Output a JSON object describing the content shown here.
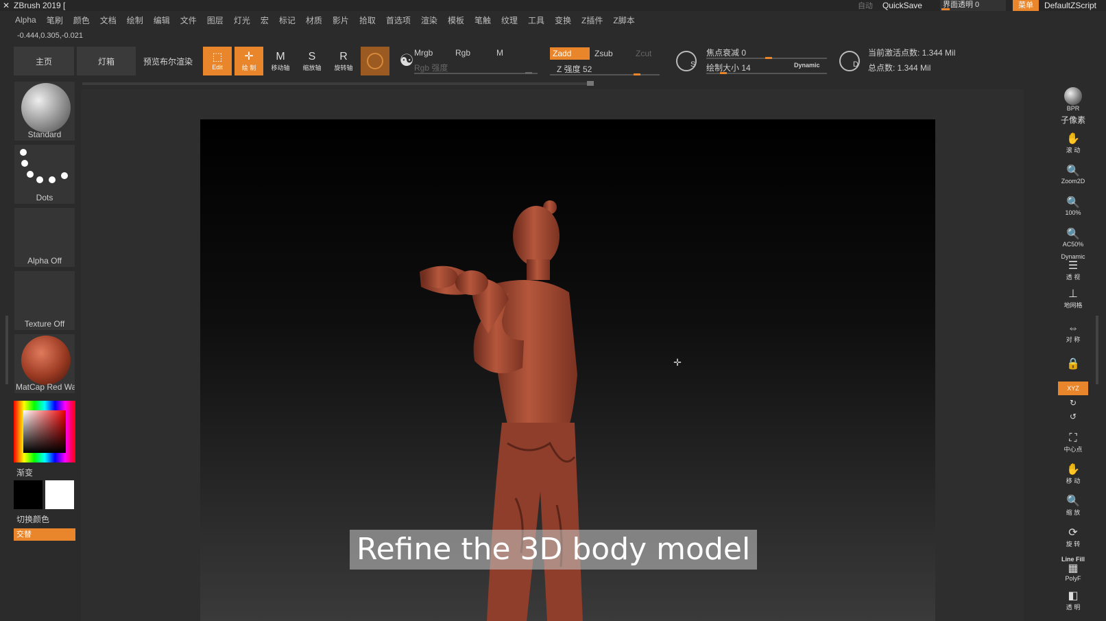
{
  "titlebar": {
    "title": "ZBrush 2019 [",
    "auto_label": "自动",
    "quicksave": "QuickSave",
    "interface_transparency": "界面透明 0",
    "menu_button": "菜单",
    "script_name": "DefaultZScript"
  },
  "menubar": {
    "items": [
      "Alpha",
      "笔刷",
      "颜色",
      "文档",
      "绘制",
      "编辑",
      "文件",
      "图层",
      "灯光",
      "宏",
      "标记",
      "材质",
      "影片",
      "拾取",
      "首选项",
      "渲染",
      "模板",
      "笔触",
      "纹理",
      "工具",
      "变换",
      "Z插件",
      "Z脚本"
    ]
  },
  "coords": "-0.444,0.305,-0.021",
  "shelf": {
    "home": "主页",
    "lightbox": "灯箱",
    "bpr_preview": "预览布尔渲染",
    "edit": "Edit",
    "draw": "绘 制",
    "move": "移动轴",
    "scale": "缩放轴",
    "rotate": "旋转轴",
    "mrgb": "Mrgb",
    "rgb": "Rgb",
    "m": "M",
    "rgb_intensity": "Rgb 强度",
    "zadd": "Zadd",
    "zsub": "Zsub",
    "zcut": "Zcut",
    "z_intensity": "Z 强度 52",
    "focal_shift": "焦点衰减 0",
    "draw_size": "绘制大小 14",
    "dynamic": "Dynamic",
    "active_points": "当前激活点数: 1.344 Mil",
    "total_points": "总点数: 1.344 Mil",
    "s_label": "S",
    "d_label": "D"
  },
  "left_panel": {
    "brush": "Standard",
    "stroke": "Dots",
    "alpha": "Alpha Off",
    "texture": "Texture Off",
    "material": "MatCap Red Wax",
    "gradient": "渐变",
    "switch_color": "切换颜色",
    "alternate": "交替"
  },
  "right_panel": {
    "bpr": "BPR",
    "subpixel": "子像素",
    "scroll": "滚 动",
    "zoom2d": "Zoom2D",
    "100": "100%",
    "ac50": "AC50%",
    "dynamic": "Dynamic",
    "persp": "透 视",
    "floor": "地网格",
    "local": "对 称",
    "xyz": "XYZ",
    "center": "中心点",
    "move": "移 动",
    "scale": "缩 放",
    "rotate": "旋 转",
    "linefill": "Line Fill",
    "polyf": "PolyF",
    "transp": "透 明"
  },
  "canvas": {
    "subtitle": "Refine the 3D body model"
  },
  "colors": {
    "accent": "#e9852a",
    "model": "#a04a35"
  }
}
